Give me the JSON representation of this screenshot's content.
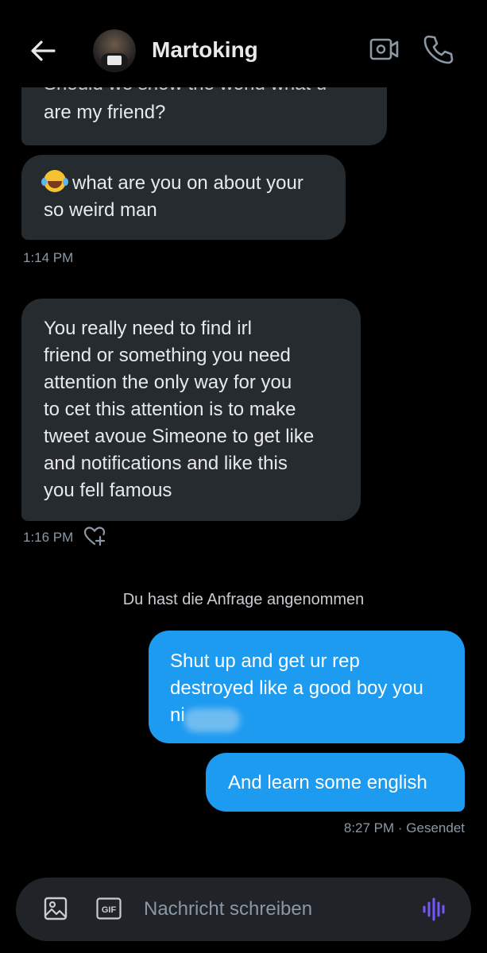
{
  "header": {
    "title": "Martoking",
    "back_icon": "arrow-left-icon",
    "video_icon": "video-call-icon",
    "phone_icon": "phone-icon"
  },
  "messages": [
    {
      "direction": "in",
      "cut_text": "Should we show the world what u",
      "text": "are my friend?"
    },
    {
      "direction": "in",
      "emoji": "laughing-tears-emoji",
      "text": "what are you on about your\nso weird man",
      "time": "1:14 PM"
    },
    {
      "direction": "in",
      "text": "You really need to find irl\nfriend or something you need\nattention the only way for you\nto cet this attention is to make\ntweet avoue Simeone to get like\nand notifications and like this\nyou fell famous",
      "time": "1:16 PM"
    },
    {
      "direction": "out",
      "text": "Shut up and get ur rep\ndestroyed like a good boy you\nni"
    },
    {
      "direction": "out",
      "text": "And learn some english",
      "time": "8:27 PM · Gesendet"
    }
  ],
  "system_message": "Du hast die Anfrage angenommen",
  "composer": {
    "placeholder": "Nachricht schreiben",
    "gif_label": "GIF"
  },
  "colors": {
    "background": "#000000",
    "incoming_bubble": "#262b30",
    "outgoing_bubble": "#1d9bf0",
    "accent_voice": "#7856ff"
  }
}
